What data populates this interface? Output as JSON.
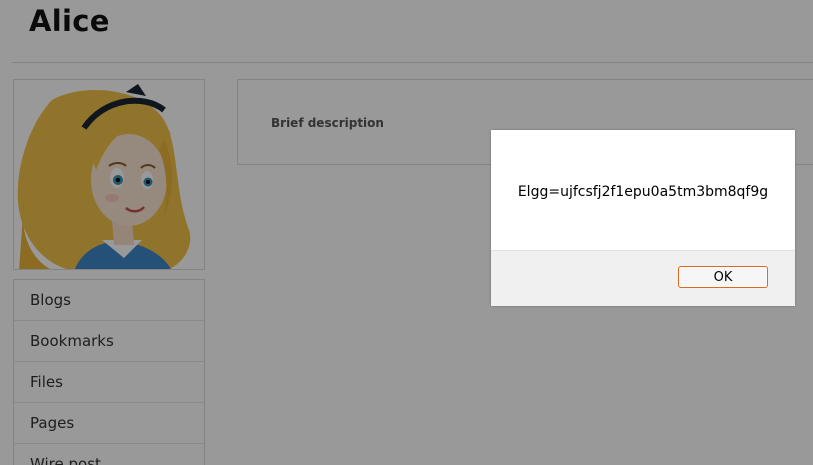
{
  "profile": {
    "name": "Alice",
    "avatar_icon": "alice-avatar-illustration",
    "brief_description_label": "Brief description"
  },
  "owner_menu": {
    "items": [
      {
        "label": "Blogs"
      },
      {
        "label": "Bookmarks"
      },
      {
        "label": "Files"
      },
      {
        "label": "Pages"
      },
      {
        "label": "Wire post"
      }
    ]
  },
  "alert": {
    "message": "Elgg=ujfcsfj2f1epu0a5tm3bm8qf9g",
    "ok_label": "OK"
  },
  "colors": {
    "overlay": "rgba(0,0,0,0.4)",
    "ok_button_border": "#e0651f",
    "dialog_footer": "#f0f0f0"
  }
}
